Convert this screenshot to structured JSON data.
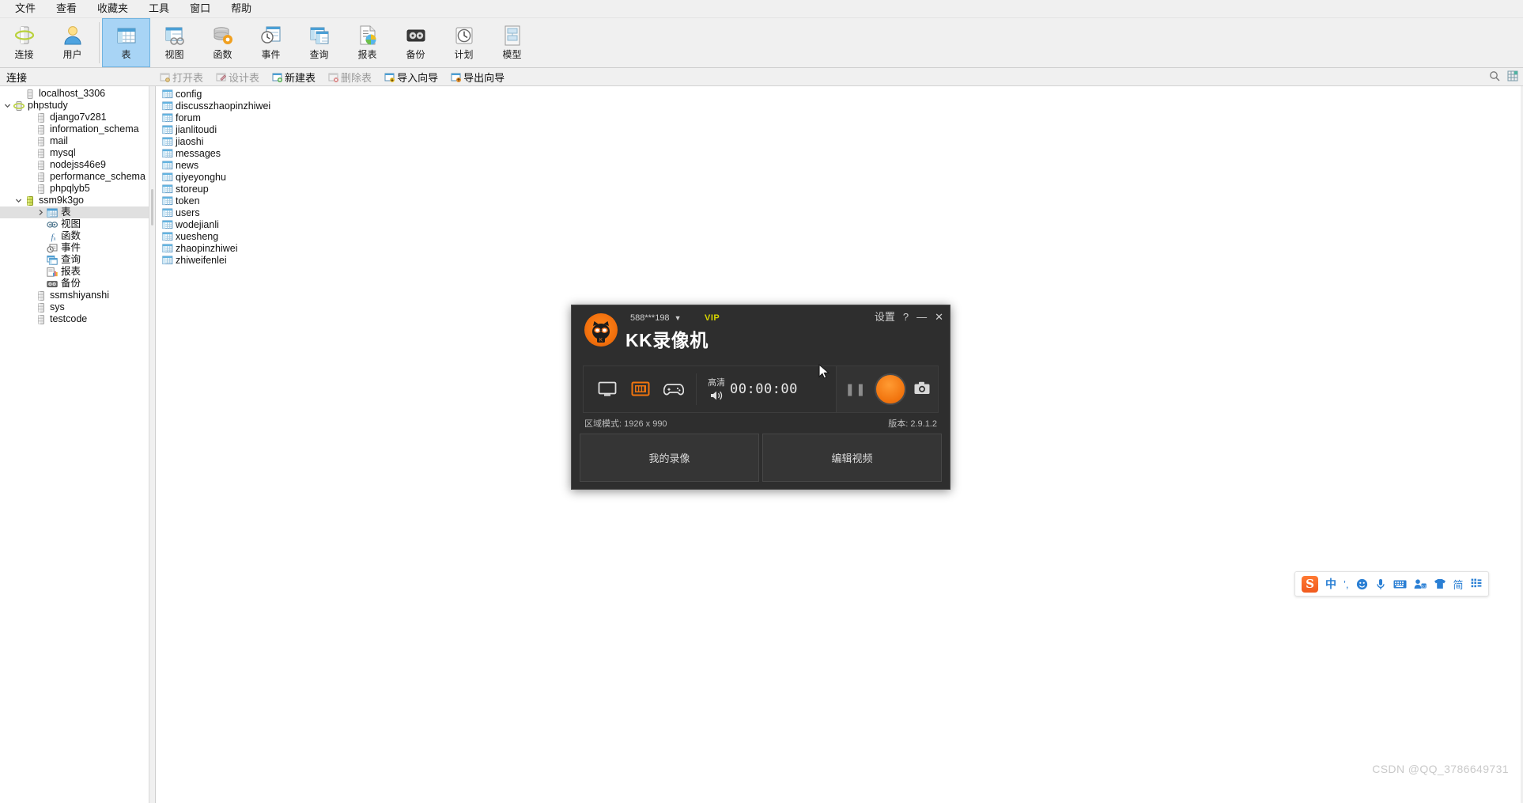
{
  "menubar": {
    "items": [
      {
        "label": "文件",
        "name": "menu-file"
      },
      {
        "label": "查看",
        "name": "menu-view"
      },
      {
        "label": "收藏夹",
        "name": "menu-favorites"
      },
      {
        "label": "工具",
        "name": "menu-tools"
      },
      {
        "label": "窗口",
        "name": "menu-window"
      },
      {
        "label": "帮助",
        "name": "menu-help"
      }
    ]
  },
  "ribbon": {
    "group1": [
      {
        "label": "连接",
        "icon": "connection-icon",
        "active": false
      },
      {
        "label": "用户",
        "icon": "user-icon",
        "active": false
      }
    ],
    "group2": [
      {
        "label": "表",
        "icon": "table-icon",
        "active": true
      },
      {
        "label": "视图",
        "icon": "view-icon",
        "active": false
      },
      {
        "label": "函数",
        "icon": "function-icon",
        "active": false
      },
      {
        "label": "事件",
        "icon": "event-icon",
        "active": false
      },
      {
        "label": "查询",
        "icon": "query-icon",
        "active": false
      },
      {
        "label": "报表",
        "icon": "report-icon",
        "active": false
      },
      {
        "label": "备份",
        "icon": "backup-icon",
        "active": false
      },
      {
        "label": "计划",
        "icon": "schedule-icon",
        "active": false
      },
      {
        "label": "模型",
        "icon": "model-icon",
        "active": false
      }
    ]
  },
  "subtoolbar": {
    "connection_label": "连接",
    "items": [
      {
        "label": "打开表",
        "name": "open-table-button",
        "enabled": false
      },
      {
        "label": "设计表",
        "name": "design-table-button",
        "enabled": false
      },
      {
        "label": "新建表",
        "name": "new-table-button",
        "enabled": true
      },
      {
        "label": "删除表",
        "name": "delete-table-button",
        "enabled": false
      },
      {
        "label": "导入向导",
        "name": "import-wizard-button",
        "enabled": true
      },
      {
        "label": "导出向导",
        "name": "export-wizard-button",
        "enabled": true
      }
    ],
    "right_icons": [
      {
        "name": "search-icon"
      },
      {
        "name": "grid-view-icon"
      }
    ]
  },
  "sidebar": {
    "tree": [
      {
        "label": "localhost_3306",
        "depth": 1,
        "icon": "server-icon",
        "twist": "",
        "selected": false
      },
      {
        "label": "phpstudy",
        "depth": 0,
        "icon": "connection-green-icon",
        "twist": "open",
        "selected": false
      },
      {
        "label": "django7v281",
        "depth": 2,
        "icon": "database-icon",
        "twist": "",
        "selected": false
      },
      {
        "label": "information_schema",
        "depth": 2,
        "icon": "database-icon",
        "twist": "",
        "selected": false
      },
      {
        "label": "mail",
        "depth": 2,
        "icon": "database-icon",
        "twist": "",
        "selected": false
      },
      {
        "label": "mysql",
        "depth": 2,
        "icon": "database-icon",
        "twist": "",
        "selected": false
      },
      {
        "label": "nodejss46e9",
        "depth": 2,
        "icon": "database-icon",
        "twist": "",
        "selected": false
      },
      {
        "label": "performance_schema",
        "depth": 2,
        "icon": "database-icon",
        "twist": "",
        "selected": false
      },
      {
        "label": "phpqlyb5",
        "depth": 2,
        "icon": "database-icon",
        "twist": "",
        "selected": false
      },
      {
        "label": "ssm9k3go",
        "depth": 1,
        "icon": "database-open-icon",
        "twist": "open",
        "selected": false
      },
      {
        "label": "表",
        "depth": 3,
        "icon": "tables-icon",
        "twist": "closed",
        "selected": true
      },
      {
        "label": "视图",
        "depth": 3,
        "icon": "views-icon",
        "twist": "",
        "selected": false
      },
      {
        "label": "函数",
        "depth": 3,
        "icon": "functions-icon",
        "twist": "",
        "selected": false
      },
      {
        "label": "事件",
        "depth": 3,
        "icon": "events-icon",
        "twist": "",
        "selected": false
      },
      {
        "label": "查询",
        "depth": 3,
        "icon": "queries-icon",
        "twist": "",
        "selected": false
      },
      {
        "label": "报表",
        "depth": 3,
        "icon": "reports-icon",
        "twist": "",
        "selected": false
      },
      {
        "label": "备份",
        "depth": 3,
        "icon": "backups-icon",
        "twist": "",
        "selected": false
      },
      {
        "label": "ssmshiyanshi",
        "depth": 2,
        "icon": "database-icon",
        "twist": "",
        "selected": false
      },
      {
        "label": "sys",
        "depth": 2,
        "icon": "database-icon",
        "twist": "",
        "selected": false
      },
      {
        "label": "testcode",
        "depth": 2,
        "icon": "database-icon",
        "twist": "",
        "selected": false
      }
    ]
  },
  "main": {
    "tables": [
      "config",
      "discusszhaopinzhiwei",
      "forum",
      "jianlitoudi",
      "jiaoshi",
      "messages",
      "news",
      "qiyeyonghu",
      "storeup",
      "token",
      "users",
      "wodejianli",
      "xuesheng",
      "zhaopinzhiwei",
      "zhiweifenlei"
    ]
  },
  "kk_recorder": {
    "account": "588***198",
    "vip_badge": "VIP",
    "settings_label": "设置",
    "help_label": "?",
    "minimize_label": "—",
    "close_label": "✕",
    "brand": "KK录像机",
    "quality_label": "高清",
    "timer": "00:00:00",
    "modes": [
      {
        "name": "screen-mode-icon",
        "active": false
      },
      {
        "name": "region-mode-icon",
        "active": true
      },
      {
        "name": "game-mode-icon",
        "active": false
      }
    ],
    "pause_label": "❚❚",
    "record_button_name": "record-button",
    "screenshot_button_name": "screenshot-button",
    "status_left": "区域模式: 1926 x 990",
    "status_right": "版本: 2.9.1.2",
    "footer_buttons": [
      {
        "label": "我的录像",
        "name": "my-recordings-button"
      },
      {
        "label": "编辑视频",
        "name": "edit-video-button"
      }
    ],
    "accent_color": "#f2750f",
    "bg_color": "#2e2e2e"
  },
  "ime": {
    "logo": "S",
    "items": [
      {
        "glyph": "中",
        "name": "chinese-mode-toggle"
      },
      {
        "glyph": "’,",
        "name": "punctuation-toggle"
      },
      {
        "glyph": "☺",
        "name": "emoji-icon"
      },
      {
        "glyph": "🎤",
        "name": "voice-input-icon"
      },
      {
        "glyph": "⌨",
        "name": "soft-keyboard-icon"
      },
      {
        "glyph": "👤",
        "name": "user-dictionary-icon"
      },
      {
        "glyph": "👕",
        "name": "skin-icon"
      },
      {
        "glyph": "简",
        "name": "simplified-toggle"
      },
      {
        "glyph": "⠿",
        "name": "toolbox-icon"
      }
    ]
  },
  "watermark": {
    "text": "CSDN @QQ_3786649731"
  }
}
